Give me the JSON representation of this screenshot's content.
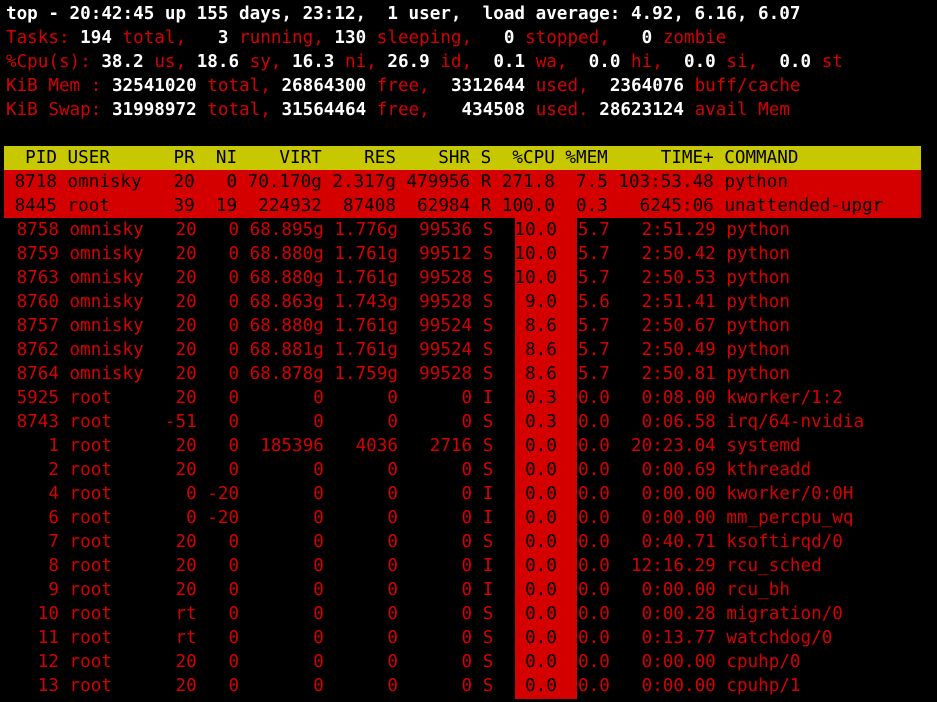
{
  "summary": {
    "line1": "top - 20:42:45 up 155 days, 23:12,  1 user,  load average: 4.92, 6.16, 6.07",
    "tasks": {
      "label": "Tasks:",
      "total": "194",
      "total_lbl": "total,",
      "running": "3",
      "running_lbl": "running,",
      "sleeping": "130",
      "sleeping_lbl": "sleeping,",
      "stopped": "0",
      "stopped_lbl": "stopped,",
      "zombie": "0",
      "zombie_lbl": "zombie"
    },
    "cpu": {
      "label": "%Cpu(s):",
      "us": "38.2",
      "sy": "18.6",
      "ni": "16.3",
      "id": "26.9",
      "wa": "0.1",
      "hi": "0.0",
      "si": "0.0",
      "st": "0.0"
    },
    "mem": {
      "label": "KiB Mem :",
      "total": "32541020",
      "free": "26864300",
      "used": "3312644",
      "buff_cache": "2364076"
    },
    "swap": {
      "label": "KiB Swap:",
      "total": "31998972",
      "free": "31564464",
      "used": "434508",
      "avail": "28623124"
    }
  },
  "table": {
    "header": "  PID USER      PR  NI    VIRT    RES    SHR S  %CPU %MEM     TIME+ COMMAND",
    "rows": [
      {
        "pid": "8718",
        "user": "omnisky",
        "pr": "20",
        "ni": "0",
        "virt": "70.170g",
        "res": "2.317g",
        "shr": "479956",
        "s": "R",
        "cpu": "271.8",
        "mem": "7.5",
        "time": "103:53.48",
        "cmd": "python",
        "highlight": true
      },
      {
        "pid": "8445",
        "user": "root",
        "pr": "39",
        "ni": "19",
        "virt": "224932",
        "res": "87408",
        "shr": "62984",
        "s": "R",
        "cpu": "100.0",
        "mem": "0.3",
        "time": "6245:06",
        "cmd": "unattended-upgr",
        "highlight": true
      },
      {
        "pid": "8758",
        "user": "omnisky",
        "pr": "20",
        "ni": "0",
        "virt": "68.895g",
        "res": "1.776g",
        "shr": "99536",
        "s": "S",
        "cpu": "10.0",
        "mem": "5.7",
        "time": "2:51.29",
        "cmd": "python"
      },
      {
        "pid": "8759",
        "user": "omnisky",
        "pr": "20",
        "ni": "0",
        "virt": "68.880g",
        "res": "1.761g",
        "shr": "99512",
        "s": "S",
        "cpu": "10.0",
        "mem": "5.7",
        "time": "2:50.42",
        "cmd": "python"
      },
      {
        "pid": "8763",
        "user": "omnisky",
        "pr": "20",
        "ni": "0",
        "virt": "68.880g",
        "res": "1.761g",
        "shr": "99528",
        "s": "S",
        "cpu": "10.0",
        "mem": "5.7",
        "time": "2:50.53",
        "cmd": "python"
      },
      {
        "pid": "8760",
        "user": "omnisky",
        "pr": "20",
        "ni": "0",
        "virt": "68.863g",
        "res": "1.743g",
        "shr": "99528",
        "s": "S",
        "cpu": "9.0",
        "mem": "5.6",
        "time": "2:51.41",
        "cmd": "python"
      },
      {
        "pid": "8757",
        "user": "omnisky",
        "pr": "20",
        "ni": "0",
        "virt": "68.880g",
        "res": "1.761g",
        "shr": "99524",
        "s": "S",
        "cpu": "8.6",
        "mem": "5.7",
        "time": "2:50.67",
        "cmd": "python"
      },
      {
        "pid": "8762",
        "user": "omnisky",
        "pr": "20",
        "ni": "0",
        "virt": "68.881g",
        "res": "1.761g",
        "shr": "99524",
        "s": "S",
        "cpu": "8.6",
        "mem": "5.7",
        "time": "2:50.49",
        "cmd": "python"
      },
      {
        "pid": "8764",
        "user": "omnisky",
        "pr": "20",
        "ni": "0",
        "virt": "68.878g",
        "res": "1.759g",
        "shr": "99528",
        "s": "S",
        "cpu": "8.6",
        "mem": "5.7",
        "time": "2:50.81",
        "cmd": "python"
      },
      {
        "pid": "5925",
        "user": "root",
        "pr": "20",
        "ni": "0",
        "virt": "0",
        "res": "0",
        "shr": "0",
        "s": "I",
        "cpu": "0.3",
        "mem": "0.0",
        "time": "0:08.00",
        "cmd": "kworker/1:2"
      },
      {
        "pid": "8743",
        "user": "root",
        "pr": "-51",
        "ni": "0",
        "virt": "0",
        "res": "0",
        "shr": "0",
        "s": "S",
        "cpu": "0.3",
        "mem": "0.0",
        "time": "0:06.58",
        "cmd": "irq/64-nvidia"
      },
      {
        "pid": "1",
        "user": "root",
        "pr": "20",
        "ni": "0",
        "virt": "185396",
        "res": "4036",
        "shr": "2716",
        "s": "S",
        "cpu": "0.0",
        "mem": "0.0",
        "time": "20:23.04",
        "cmd": "systemd"
      },
      {
        "pid": "2",
        "user": "root",
        "pr": "20",
        "ni": "0",
        "virt": "0",
        "res": "0",
        "shr": "0",
        "s": "S",
        "cpu": "0.0",
        "mem": "0.0",
        "time": "0:00.69",
        "cmd": "kthreadd"
      },
      {
        "pid": "4",
        "user": "root",
        "pr": "0",
        "ni": "-20",
        "virt": "0",
        "res": "0",
        "shr": "0",
        "s": "I",
        "cpu": "0.0",
        "mem": "0.0",
        "time": "0:00.00",
        "cmd": "kworker/0:0H"
      },
      {
        "pid": "6",
        "user": "root",
        "pr": "0",
        "ni": "-20",
        "virt": "0",
        "res": "0",
        "shr": "0",
        "s": "I",
        "cpu": "0.0",
        "mem": "0.0",
        "time": "0:00.00",
        "cmd": "mm_percpu_wq"
      },
      {
        "pid": "7",
        "user": "root",
        "pr": "20",
        "ni": "0",
        "virt": "0",
        "res": "0",
        "shr": "0",
        "s": "S",
        "cpu": "0.0",
        "mem": "0.0",
        "time": "0:40.71",
        "cmd": "ksoftirqd/0"
      },
      {
        "pid": "8",
        "user": "root",
        "pr": "20",
        "ni": "0",
        "virt": "0",
        "res": "0",
        "shr": "0",
        "s": "I",
        "cpu": "0.0",
        "mem": "0.0",
        "time": "12:16.29",
        "cmd": "rcu_sched"
      },
      {
        "pid": "9",
        "user": "root",
        "pr": "20",
        "ni": "0",
        "virt": "0",
        "res": "0",
        "shr": "0",
        "s": "I",
        "cpu": "0.0",
        "mem": "0.0",
        "time": "0:00.00",
        "cmd": "rcu_bh"
      },
      {
        "pid": "10",
        "user": "root",
        "pr": "rt",
        "ni": "0",
        "virt": "0",
        "res": "0",
        "shr": "0",
        "s": "S",
        "cpu": "0.0",
        "mem": "0.0",
        "time": "0:00.28",
        "cmd": "migration/0"
      },
      {
        "pid": "11",
        "user": "root",
        "pr": "rt",
        "ni": "0",
        "virt": "0",
        "res": "0",
        "shr": "0",
        "s": "S",
        "cpu": "0.0",
        "mem": "0.0",
        "time": "0:13.77",
        "cmd": "watchdog/0"
      },
      {
        "pid": "12",
        "user": "root",
        "pr": "20",
        "ni": "0",
        "virt": "0",
        "res": "0",
        "shr": "0",
        "s": "S",
        "cpu": "0.0",
        "mem": "0.0",
        "time": "0:00.00",
        "cmd": "cpuhp/0"
      },
      {
        "pid": "13",
        "user": "root",
        "pr": "20",
        "ni": "0",
        "virt": "0",
        "res": "0",
        "shr": "0",
        "s": "S",
        "cpu": "0.0",
        "mem": "0.0",
        "time": "0:00.00",
        "cmd": "cpuhp/1"
      }
    ]
  },
  "colors": {
    "background": "#000000",
    "accent_red": "#d40000",
    "header_yellow": "#c8c800",
    "value_white": "#ffffff"
  }
}
